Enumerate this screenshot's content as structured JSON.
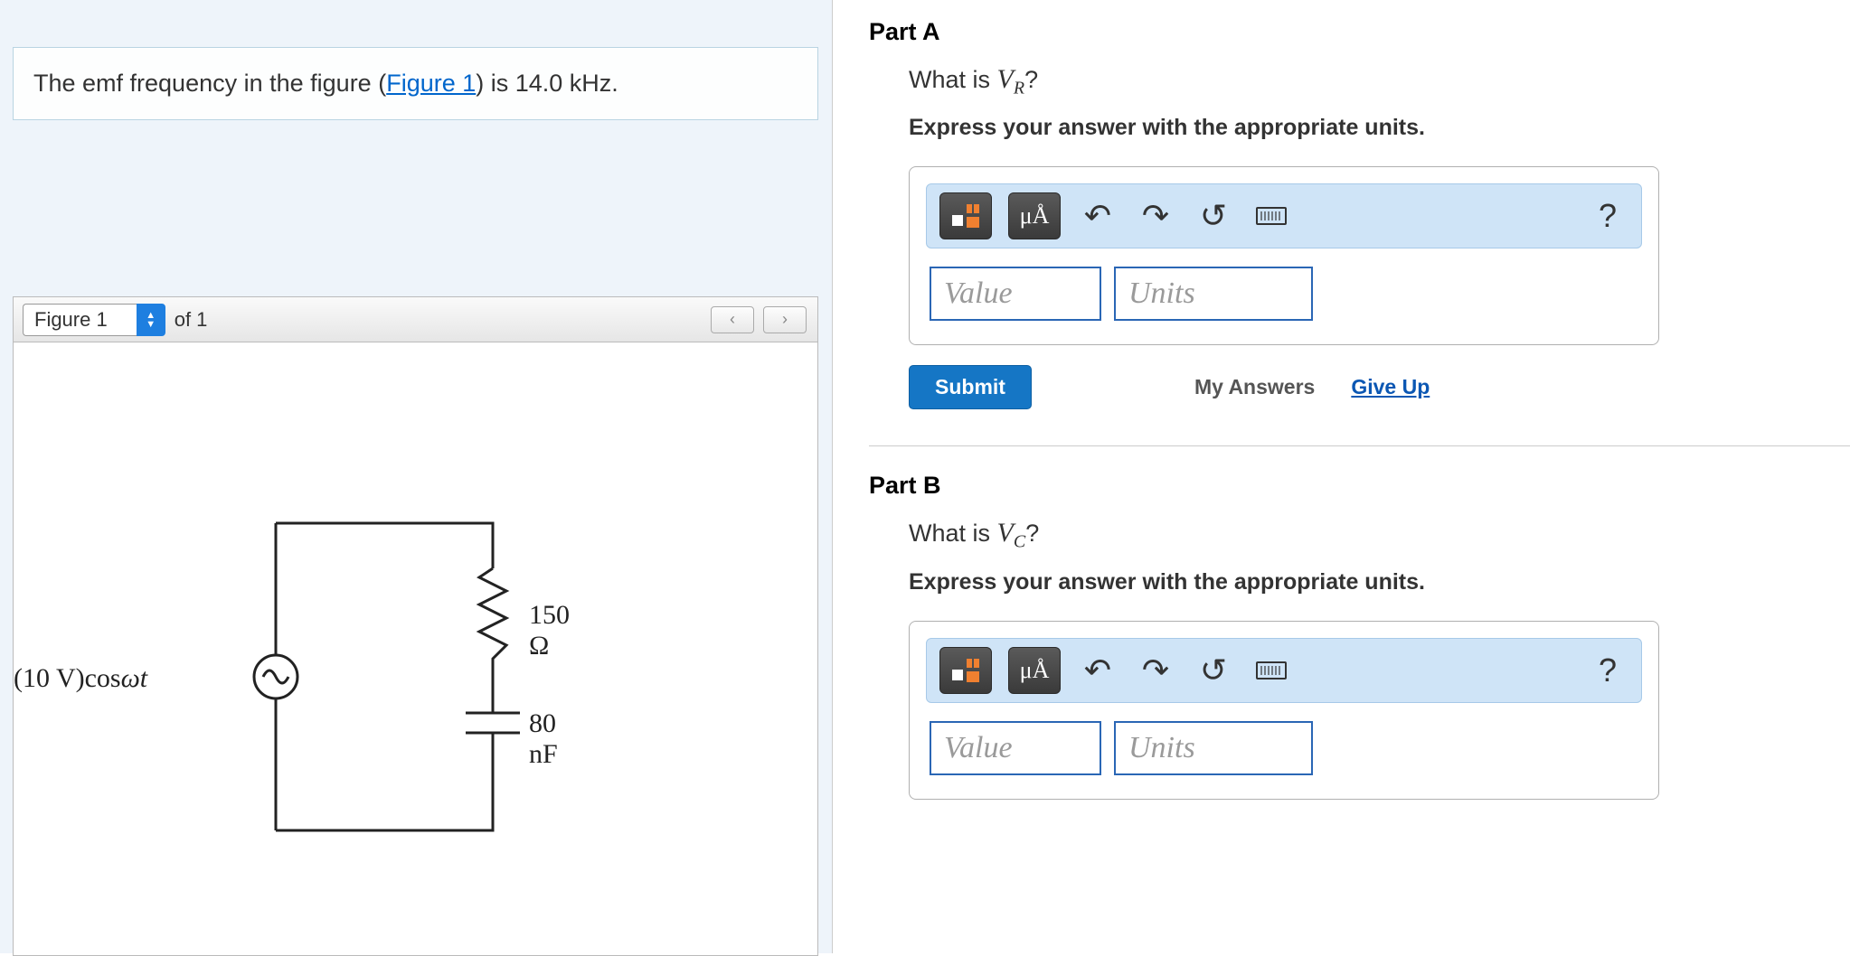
{
  "problem": {
    "prefix": "The emf frequency in the figure (",
    "link_text": "Figure 1",
    "suffix": ") is 14.0 kHz."
  },
  "figure": {
    "selector_label": "Figure 1",
    "of_text": "of 1",
    "source_label": "(10 V)cosωt",
    "resistor_label": "150 Ω",
    "capacitor_label": "80 nF"
  },
  "partA": {
    "heading": "Part A",
    "q_prefix": "What is ",
    "q_var": "V",
    "q_sub": "R",
    "q_suffix": "?",
    "instruction": "Express your answer with the appropriate units.",
    "value_placeholder": "Value",
    "units_placeholder": "Units",
    "units_btn": "μÅ",
    "submit": "Submit",
    "my_answers": "My Answers",
    "give_up": "Give Up",
    "help": "?"
  },
  "partB": {
    "heading": "Part B",
    "q_prefix": "What is ",
    "q_var": "V",
    "q_sub": "C",
    "q_suffix": "?",
    "instruction": "Express your answer with the appropriate units.",
    "value_placeholder": "Value",
    "units_placeholder": "Units",
    "units_btn": "μÅ",
    "help": "?"
  }
}
